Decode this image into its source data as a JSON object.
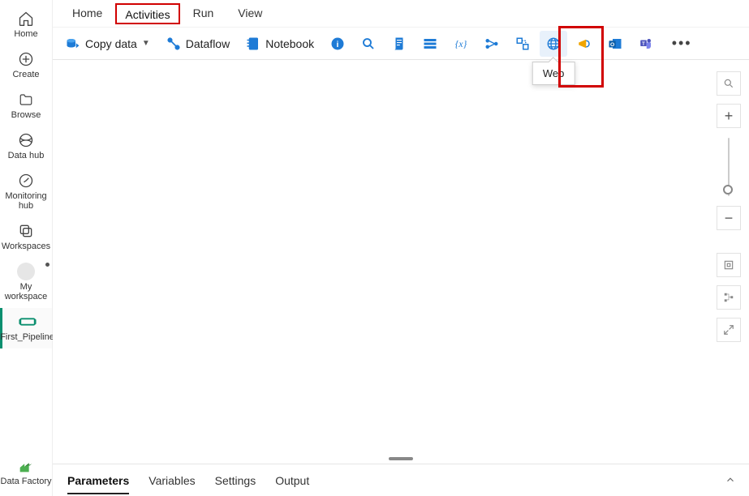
{
  "rail": {
    "home": "Home",
    "create": "Create",
    "browse": "Browse",
    "datahub": "Data hub",
    "monitoring": "Monitoring hub",
    "workspaces": "Workspaces",
    "myws": "My workspace",
    "pipeline": "First_Pipeline",
    "datafactory": "Data Factory"
  },
  "tabs": {
    "home": "Home",
    "activities": "Activities",
    "run": "Run",
    "view": "View"
  },
  "toolbar": {
    "copydata": "Copy data",
    "dataflow": "Dataflow",
    "notebook": "Notebook",
    "web_tooltip": "Web"
  },
  "bottom": {
    "parameters": "Parameters",
    "variables": "Variables",
    "settings": "Settings",
    "output": "Output"
  }
}
